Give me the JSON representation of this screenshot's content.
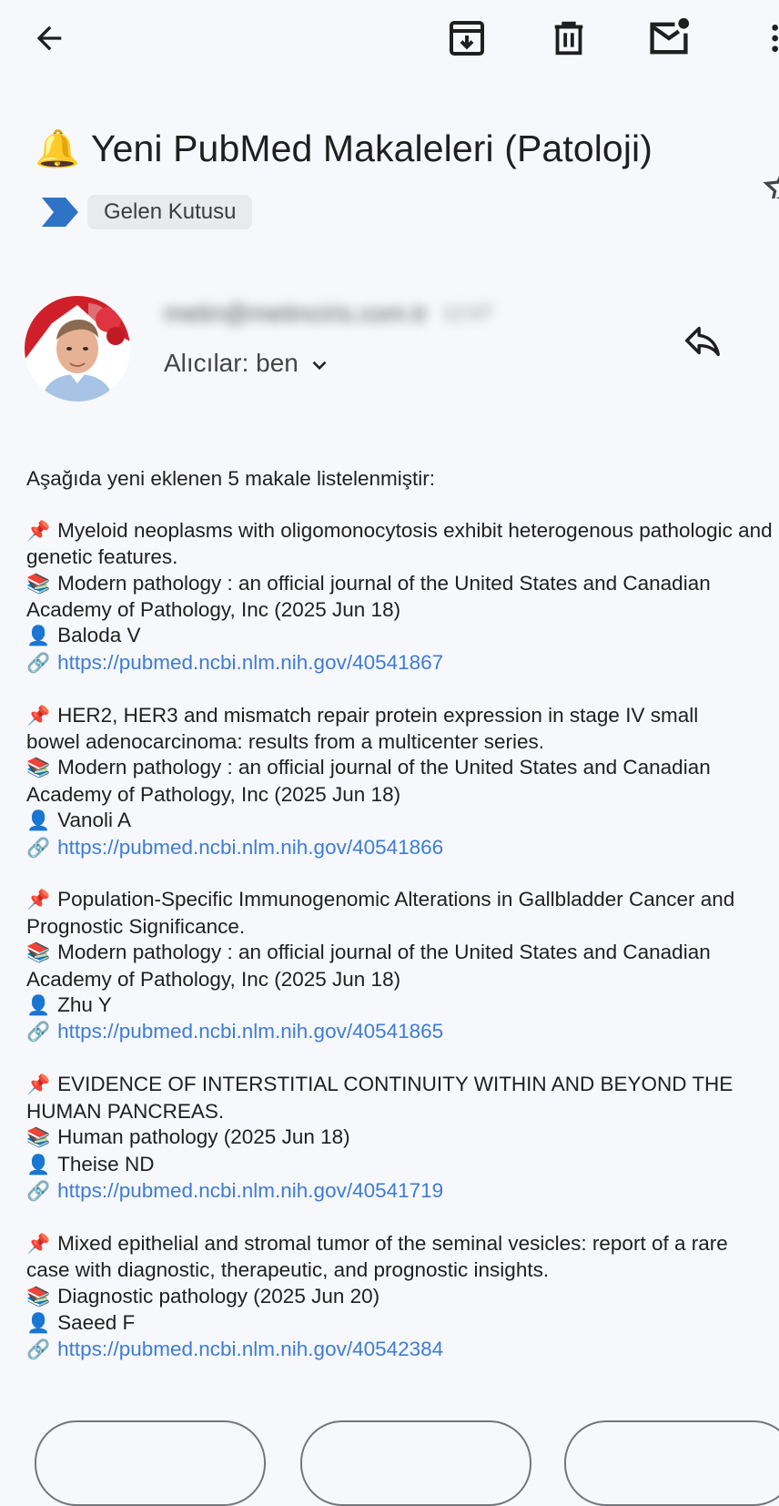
{
  "toolbar": {
    "back_icon": "arrow-back-icon",
    "archive_icon": "archive-icon",
    "delete_icon": "delete-icon",
    "mark_unread_icon": "mark-unread-icon",
    "more_icon": "more-vert-icon"
  },
  "email": {
    "subject_emoji": "🔔",
    "subject": "Yeni PubMed Makaleleri (Patoloji)",
    "label": "Gelen Kutusu",
    "sender": "metin@metinciris.com.tr",
    "time": "12:07",
    "recipients": "Alıcılar: ben",
    "intro": "Aşağıda yeni eklenen 5 makale listelenmiştir:"
  },
  "articles": [
    {
      "title": "Myeloid neoplasms with oligomonocytosis exhibit heterogenous pathologic and genetic features.",
      "source": "Modern pathology : an official journal of the United States and Canadian Academy of Pathology, Inc (2025 Jun 18)",
      "author": "Baloda V",
      "url": "https://pubmed.ncbi.nlm.nih.gov/40541867"
    },
    {
      "title": "HER2, HER3 and mismatch repair protein expression in stage IV small bowel adenocarcinoma: results from a multicenter series.",
      "source": "Modern pathology : an official journal of the United States and Canadian Academy of Pathology, Inc (2025 Jun 18)",
      "author": "Vanoli A",
      "url": "https://pubmed.ncbi.nlm.nih.gov/40541866"
    },
    {
      "title": "Population-Specific Immunogenomic Alterations in Gallbladder Cancer and Prognostic Significance.",
      "source": "Modern pathology : an official journal of the United States and Canadian Academy of Pathology, Inc (2025 Jun 18)",
      "author": "Zhu Y",
      "url": "https://pubmed.ncbi.nlm.nih.gov/40541865"
    },
    {
      "title": "EVIDENCE OF INTERSTITIAL CONTINUITY WITHIN AND BEYOND THE HUMAN PANCREAS.",
      "source": "Human pathology (2025 Jun 18)",
      "author": "Theise ND",
      "url": "https://pubmed.ncbi.nlm.nih.gov/40541719"
    },
    {
      "title": "Mixed epithelial and stromal tumor of the seminal vesicles: report of a rare case with diagnostic, therapeutic, and prognostic insights.",
      "source": "Diagnostic pathology (2025 Jun 20)",
      "author": "Saeed F",
      "url": "https://pubmed.ncbi.nlm.nih.gov/40542384"
    }
  ],
  "emoji": {
    "pin": "📌",
    "books": "📚",
    "person": "👤",
    "link": "🔗"
  },
  "colors": {
    "background": "#f7f8fc",
    "link": "#3d7cd6",
    "label_arrow": "#2f73c7",
    "label_chip": "#e9eaee"
  }
}
